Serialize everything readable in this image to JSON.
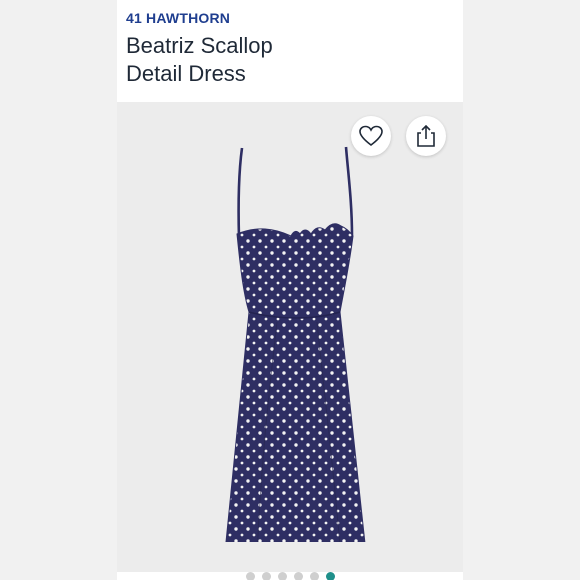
{
  "product": {
    "brand": "41 HAWTHORN",
    "title_line1": "Beatriz Scallop",
    "title_line2": "Detail Dress"
  },
  "icons": {
    "favorite": "heart-icon",
    "share": "share-icon"
  },
  "carousel": {
    "count": 6,
    "active_index": 5
  },
  "colors": {
    "brand": "#1f3e8f",
    "dress": "#2e2e63",
    "dots_active": "#1f8f8a"
  }
}
